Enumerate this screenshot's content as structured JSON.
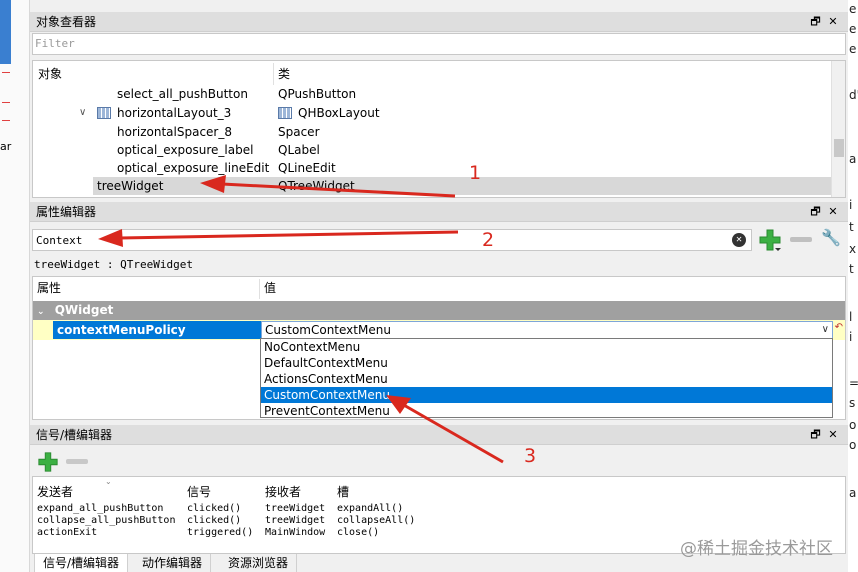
{
  "left_strip": {
    "text": "ar"
  },
  "right_strip": {
    "chars": [
      "e",
      "e",
      "e",
      "d'",
      "a",
      "i",
      "t",
      "x",
      "t",
      "i",
      "l",
      "=",
      "s",
      "o",
      "o",
      "a"
    ]
  },
  "object_inspector": {
    "title": "对象查看器",
    "filter_placeholder": "Filter",
    "columns": [
      "对象",
      "类"
    ],
    "rows": [
      {
        "object": "select_all_pushButton",
        "class": "QPushButton"
      },
      {
        "object": "horizontalLayout_3",
        "class": "QHBoxLayout"
      },
      {
        "object": "horizontalSpacer_8",
        "class": "Spacer"
      },
      {
        "object": "optical_exposure_label",
        "class": "QLabel"
      },
      {
        "object": "optical_exposure_lineEdit",
        "class": "QLineEdit"
      },
      {
        "object": "treeWidget",
        "class": "QTreeWidget"
      }
    ]
  },
  "property_editor": {
    "title": "属性编辑器",
    "filter_value": "Context",
    "class_line": "treeWidget : QTreeWidget",
    "columns": [
      "属性",
      "值"
    ],
    "group": "QWidget",
    "property_name": "contextMenuPolicy",
    "property_value": "CustomContextMenu",
    "options": [
      "NoContextMenu",
      "DefaultContextMenu",
      "ActionsContextMenu",
      "CustomContextMenu",
      "PreventContextMenu"
    ],
    "selected_option": "CustomContextMenu"
  },
  "signal_slot_editor": {
    "title": "信号/槽编辑器",
    "columns": [
      "发送者",
      "信号",
      "接收者",
      "槽"
    ],
    "senders": [
      "expand_all_pushButton",
      "collapse_all_pushButton",
      "actionExit"
    ],
    "signals": [
      "clicked()",
      "clicked()",
      "triggered()"
    ],
    "receivers": [
      "treeWidget",
      "treeWidget",
      "MainWindow"
    ],
    "slots": [
      "expandAll()",
      "collapseAll()",
      "close()"
    ]
  },
  "tabs": [
    "信号/槽编辑器",
    "动作编辑器",
    "资源浏览器"
  ],
  "dock_buttons": {
    "float": "🗗",
    "close": "✕"
  },
  "annotations": [
    "1",
    "2",
    "3"
  ],
  "watermark": "@稀土掘金技术社区",
  "colors": {
    "selection": "#0078d7",
    "annotation": "#d9281e",
    "group_header": "#a0a0a0",
    "add_green": "#3cb043"
  }
}
